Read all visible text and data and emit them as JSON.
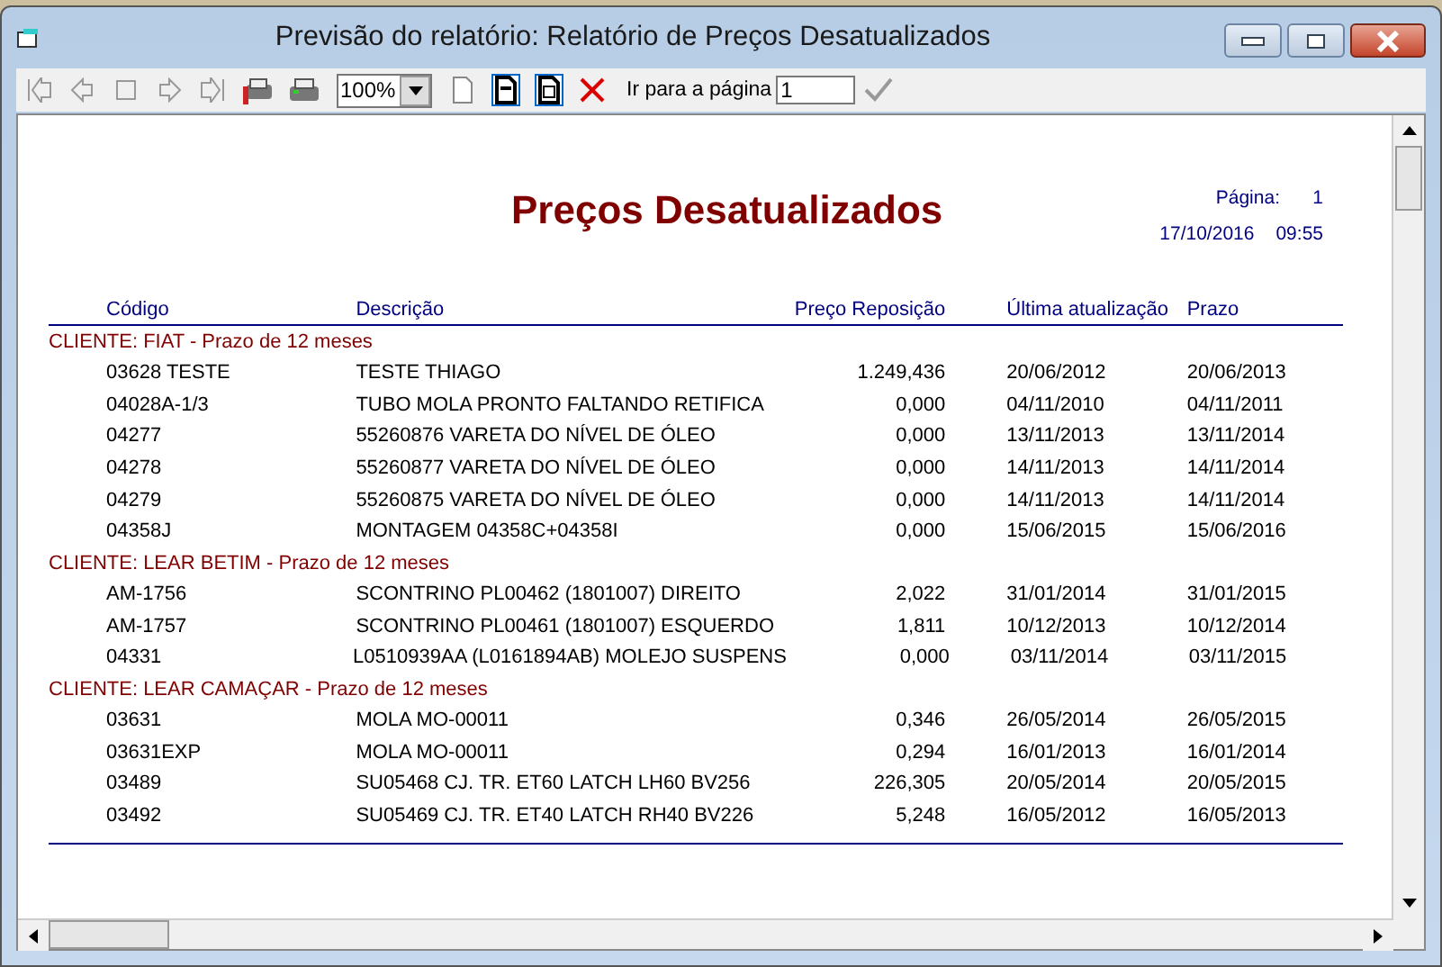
{
  "window": {
    "title": "Previsão do relatório: Relatório de Preços Desatualizados"
  },
  "toolbar": {
    "buttons": [
      {
        "kind": "first",
        "disabled": true
      },
      {
        "kind": "prev",
        "disabled": true
      },
      {
        "kind": "stop",
        "disabled": true
      },
      {
        "kind": "next",
        "disabled": true
      },
      {
        "kind": "last",
        "disabled": true
      },
      {
        "kind": "print-setup",
        "disabled": false
      },
      {
        "kind": "print",
        "disabled": false
      }
    ],
    "zoom": "100%",
    "view_buttons": [
      {
        "kind": "page",
        "selected": false
      },
      {
        "kind": "width",
        "selected": true
      },
      {
        "kind": "whole",
        "selected": true
      }
    ],
    "close_disabled": false,
    "goto_label": "Ir para a página",
    "goto_value": "1"
  },
  "report": {
    "title": "Preços Desatualizados",
    "page_label": "Página:",
    "page_number": "1",
    "date": "17/10/2016",
    "time": "09:55",
    "columns": [
      "Código",
      "Descrição",
      "Preço Reposição",
      "Última atualização",
      "Prazo"
    ],
    "groups": [
      {
        "label": "CLIENTE: FIAT - Prazo de 12 meses",
        "rows": [
          [
            "03628 TESTE",
            "TESTE THIAGO",
            "1.249,436",
            "20/06/2012",
            "20/06/2013"
          ],
          [
            "04028A-1/3",
            "TUBO MOLA PRONTO FALTANDO RETIFICA",
            "0,000",
            "04/11/2010",
            "04/11/2011"
          ],
          [
            "04277",
            "55260876 VARETA DO NÍVEL DE ÓLEO",
            "0,000",
            "13/11/2013",
            "13/11/2014"
          ],
          [
            "04278",
            "55260877 VARETA DO NÍVEL DE ÓLEO",
            "0,000",
            "14/11/2013",
            "14/11/2014"
          ],
          [
            "04279",
            "55260875 VARETA DO NÍVEL DE ÓLEO",
            "0,000",
            "14/11/2013",
            "14/11/2014"
          ],
          [
            "04358J",
            "MONTAGEM 04358C+04358I",
            "0,000",
            "15/06/2015",
            "15/06/2016"
          ]
        ]
      },
      {
        "label": "CLIENTE: LEAR BETIM - Prazo de 12 meses",
        "rows": [
          [
            "AM-1756",
            "SCONTRINO PL00462 (1801007) DIREITO",
            "2,022",
            "31/01/2014",
            "31/01/2015"
          ],
          [
            "AM-1757",
            "SCONTRINO PL00461 (1801007) ESQUERDO",
            "1,811",
            "10/12/2013",
            "10/12/2014"
          ],
          [
            "04331",
            "L0510939AA (L0161894AB) MOLEJO SUSPENS",
            "0,000",
            "03/11/2014",
            "03/11/2015"
          ]
        ]
      },
      {
        "label": "CLIENTE: LEAR CAMAÇAR - Prazo de 12 meses",
        "rows": [
          [
            "03631",
            "MOLA MO-00011",
            "0,346",
            "26/05/2014",
            "26/05/2015"
          ],
          [
            "03631EXP",
            "MOLA MO-00011",
            "0,294",
            "16/01/2013",
            "16/01/2014"
          ],
          [
            "03489",
            "SU05468 CJ. TR. ET60 LATCH LH60 BV256",
            "226,305",
            "20/05/2014",
            "20/05/2015"
          ],
          [
            "03492",
            "SU05469 CJ. TR. ET40 LATCH RH40 BV226",
            "5,248",
            "16/05/2012",
            "16/05/2013"
          ]
        ]
      }
    ]
  }
}
